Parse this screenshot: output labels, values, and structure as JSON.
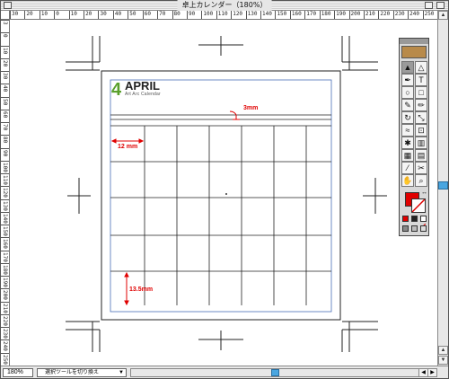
{
  "window": {
    "title": "卓上カレンダー（180%）"
  },
  "rulers": {
    "top_labels": [
      "30",
      "20",
      "10",
      "0",
      "10",
      "20",
      "30",
      "40",
      "50",
      "60",
      "70",
      "80",
      "90",
      "100",
      "110",
      "120",
      "130",
      "140",
      "150",
      "160",
      "170",
      "180",
      "190",
      "200",
      "210",
      "220",
      "230",
      "240",
      "250"
    ],
    "left_labels": [
      "3",
      "0",
      "10",
      "20",
      "30",
      "40",
      "50",
      "60",
      "70",
      "80",
      "90",
      "100",
      "110",
      "120",
      "130",
      "140",
      "150",
      "160",
      "170",
      "180",
      "190",
      "200",
      "210",
      "220",
      "230",
      "240",
      "250"
    ]
  },
  "calendar": {
    "day_number": "4",
    "month": "APRIL",
    "subtitle": "Art Arc Calendar"
  },
  "annotations": {
    "gap": "3mm",
    "column_width": "12 mm",
    "row_height": "13.5mm"
  },
  "status": {
    "zoom": "180%",
    "tool_hint": "選択ツールを切り換え",
    "dropdown_arrow": "▼"
  },
  "scroll": {
    "up_arrow": "▲",
    "down_arrow": "▼",
    "left_arrow": "◀",
    "right_arrow": "▶"
  },
  "colors": {
    "accent_red": "#e00000",
    "accent_green": "#5aa02c",
    "guide_blue": "#4a6fb8",
    "scroll_thumb": "#4aa6e0"
  },
  "toolbox": {
    "tools": [
      {
        "name": "selection-tool-icon",
        "glyph": "▲"
      },
      {
        "name": "direct-selection-tool-icon",
        "glyph": "△"
      },
      {
        "name": "pen-tool-icon",
        "glyph": "✒"
      },
      {
        "name": "type-tool-icon",
        "glyph": "T"
      },
      {
        "name": "ellipse-tool-icon",
        "glyph": "○"
      },
      {
        "name": "rectangle-tool-icon",
        "glyph": "□"
      },
      {
        "name": "brush-tool-icon",
        "glyph": "✎"
      },
      {
        "name": "pencil-tool-icon",
        "glyph": "✏"
      },
      {
        "name": "rotate-tool-icon",
        "glyph": "↻"
      },
      {
        "name": "scale-tool-icon",
        "glyph": "⤡"
      },
      {
        "name": "warp-tool-icon",
        "glyph": "≈"
      },
      {
        "name": "free-transform-tool-icon",
        "glyph": "⊡"
      },
      {
        "name": "symbol-sprayer-tool-icon",
        "glyph": "✱"
      },
      {
        "name": "graph-tool-icon",
        "glyph": "▥"
      },
      {
        "name": "mesh-tool-icon",
        "glyph": "▦"
      },
      {
        "name": "gradient-tool-icon",
        "glyph": "▤"
      },
      {
        "name": "eyedropper-tool-icon",
        "glyph": "⁄"
      },
      {
        "name": "scissors-tool-icon",
        "glyph": "✂"
      },
      {
        "name": "hand-tool-icon",
        "glyph": "✋"
      },
      {
        "name": "zoom-tool-icon",
        "glyph": "⌕"
      }
    ]
  }
}
